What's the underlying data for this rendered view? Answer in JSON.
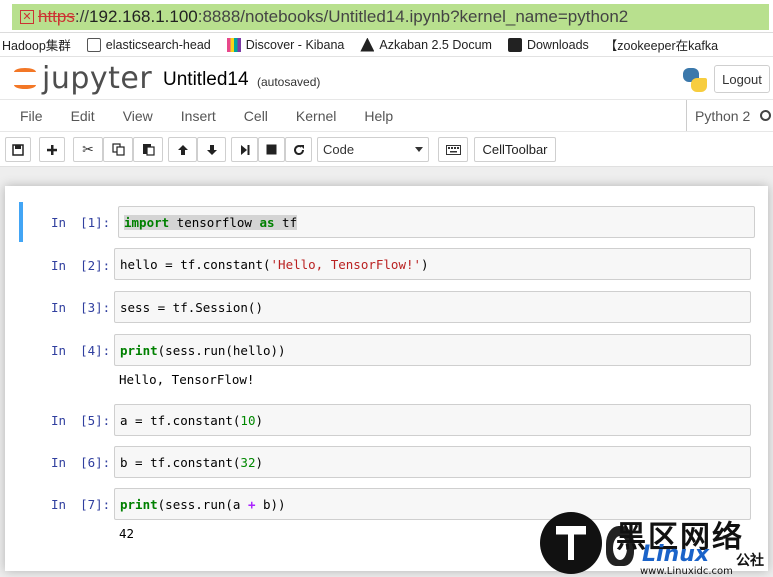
{
  "browser": {
    "url_scheme": "https",
    "url_sep": "://",
    "url_host": "192.168.1.100",
    "url_port_path": ":8888/notebooks/Untitled14.ipynb?kernel_name=python2"
  },
  "bookmarks": [
    {
      "label": "Hadoop集群",
      "icon": "none"
    },
    {
      "label": "elasticsearch-head",
      "icon": "elasticsearch-icon"
    },
    {
      "label": "Discover - Kibana",
      "icon": "kibana-icon"
    },
    {
      "label": "Azkaban 2.5 Docum",
      "icon": "azkaban-icon"
    },
    {
      "label": "Downloads",
      "icon": "downloads-icon"
    },
    {
      "label": "【zookeeper在kafka",
      "icon": "none"
    }
  ],
  "header": {
    "logo_text": "jupyter",
    "notebook_title": "Untitled14",
    "autosave": "(autosaved)",
    "logout": "Logout"
  },
  "menubar": {
    "items": [
      "File",
      "Edit",
      "View",
      "Insert",
      "Cell",
      "Kernel",
      "Help"
    ],
    "kernel": "Python 2"
  },
  "toolbar": {
    "cell_type": "Code",
    "celltoolbar": "CellToolbar"
  },
  "cells": [
    {
      "prompt": "In",
      "number": "[1]:",
      "selected": true,
      "code": [
        {
          "t": "import",
          "c": "kw hl"
        },
        {
          "t": " tensorflow ",
          "c": "hl"
        },
        {
          "t": "as",
          "c": "kw hl"
        },
        {
          "t": " tf",
          "c": "hl"
        }
      ],
      "output": ""
    },
    {
      "prompt": "In",
      "number": "[2]:",
      "selected": false,
      "code": [
        {
          "t": "hello = tf.constant(",
          "c": ""
        },
        {
          "t": "'Hello, TensorFlow!'",
          "c": "str"
        },
        {
          "t": ")",
          "c": ""
        }
      ],
      "output": ""
    },
    {
      "prompt": "In",
      "number": "[3]:",
      "selected": false,
      "code": [
        {
          "t": "sess = tf.Session()",
          "c": ""
        }
      ],
      "output": ""
    },
    {
      "prompt": "In",
      "number": "[4]:",
      "selected": false,
      "code": [
        {
          "t": "print",
          "c": "kw"
        },
        {
          "t": "(sess.run(hello))",
          "c": ""
        }
      ],
      "output": "Hello, TensorFlow!"
    },
    {
      "prompt": "In",
      "number": "[5]:",
      "selected": false,
      "code": [
        {
          "t": "a = tf.constant(",
          "c": ""
        },
        {
          "t": "10",
          "c": "num"
        },
        {
          "t": ")",
          "c": ""
        }
      ],
      "output": ""
    },
    {
      "prompt": "In",
      "number": "[6]:",
      "selected": false,
      "code": [
        {
          "t": "b = tf.constant(",
          "c": ""
        },
        {
          "t": "32",
          "c": "num"
        },
        {
          "t": ")",
          "c": ""
        }
      ],
      "output": ""
    },
    {
      "prompt": "In",
      "number": "[7]:",
      "selected": false,
      "code": [
        {
          "t": "print",
          "c": "kw"
        },
        {
          "t": "(sess.run(a ",
          "c": ""
        },
        {
          "t": "+",
          "c": "op"
        },
        {
          "t": " b))",
          "c": ""
        }
      ],
      "output": "42"
    }
  ],
  "watermark": {
    "title": "黑区网络",
    "sub": "Linux",
    "sub2": "公社",
    "url": "www.Linuxidc.com"
  },
  "colors": {
    "url_bar": "#b8e08e",
    "selected_cell_border": "#42a5f5",
    "prompt": "#303f9f",
    "jupyter_orange": "#f37726"
  }
}
